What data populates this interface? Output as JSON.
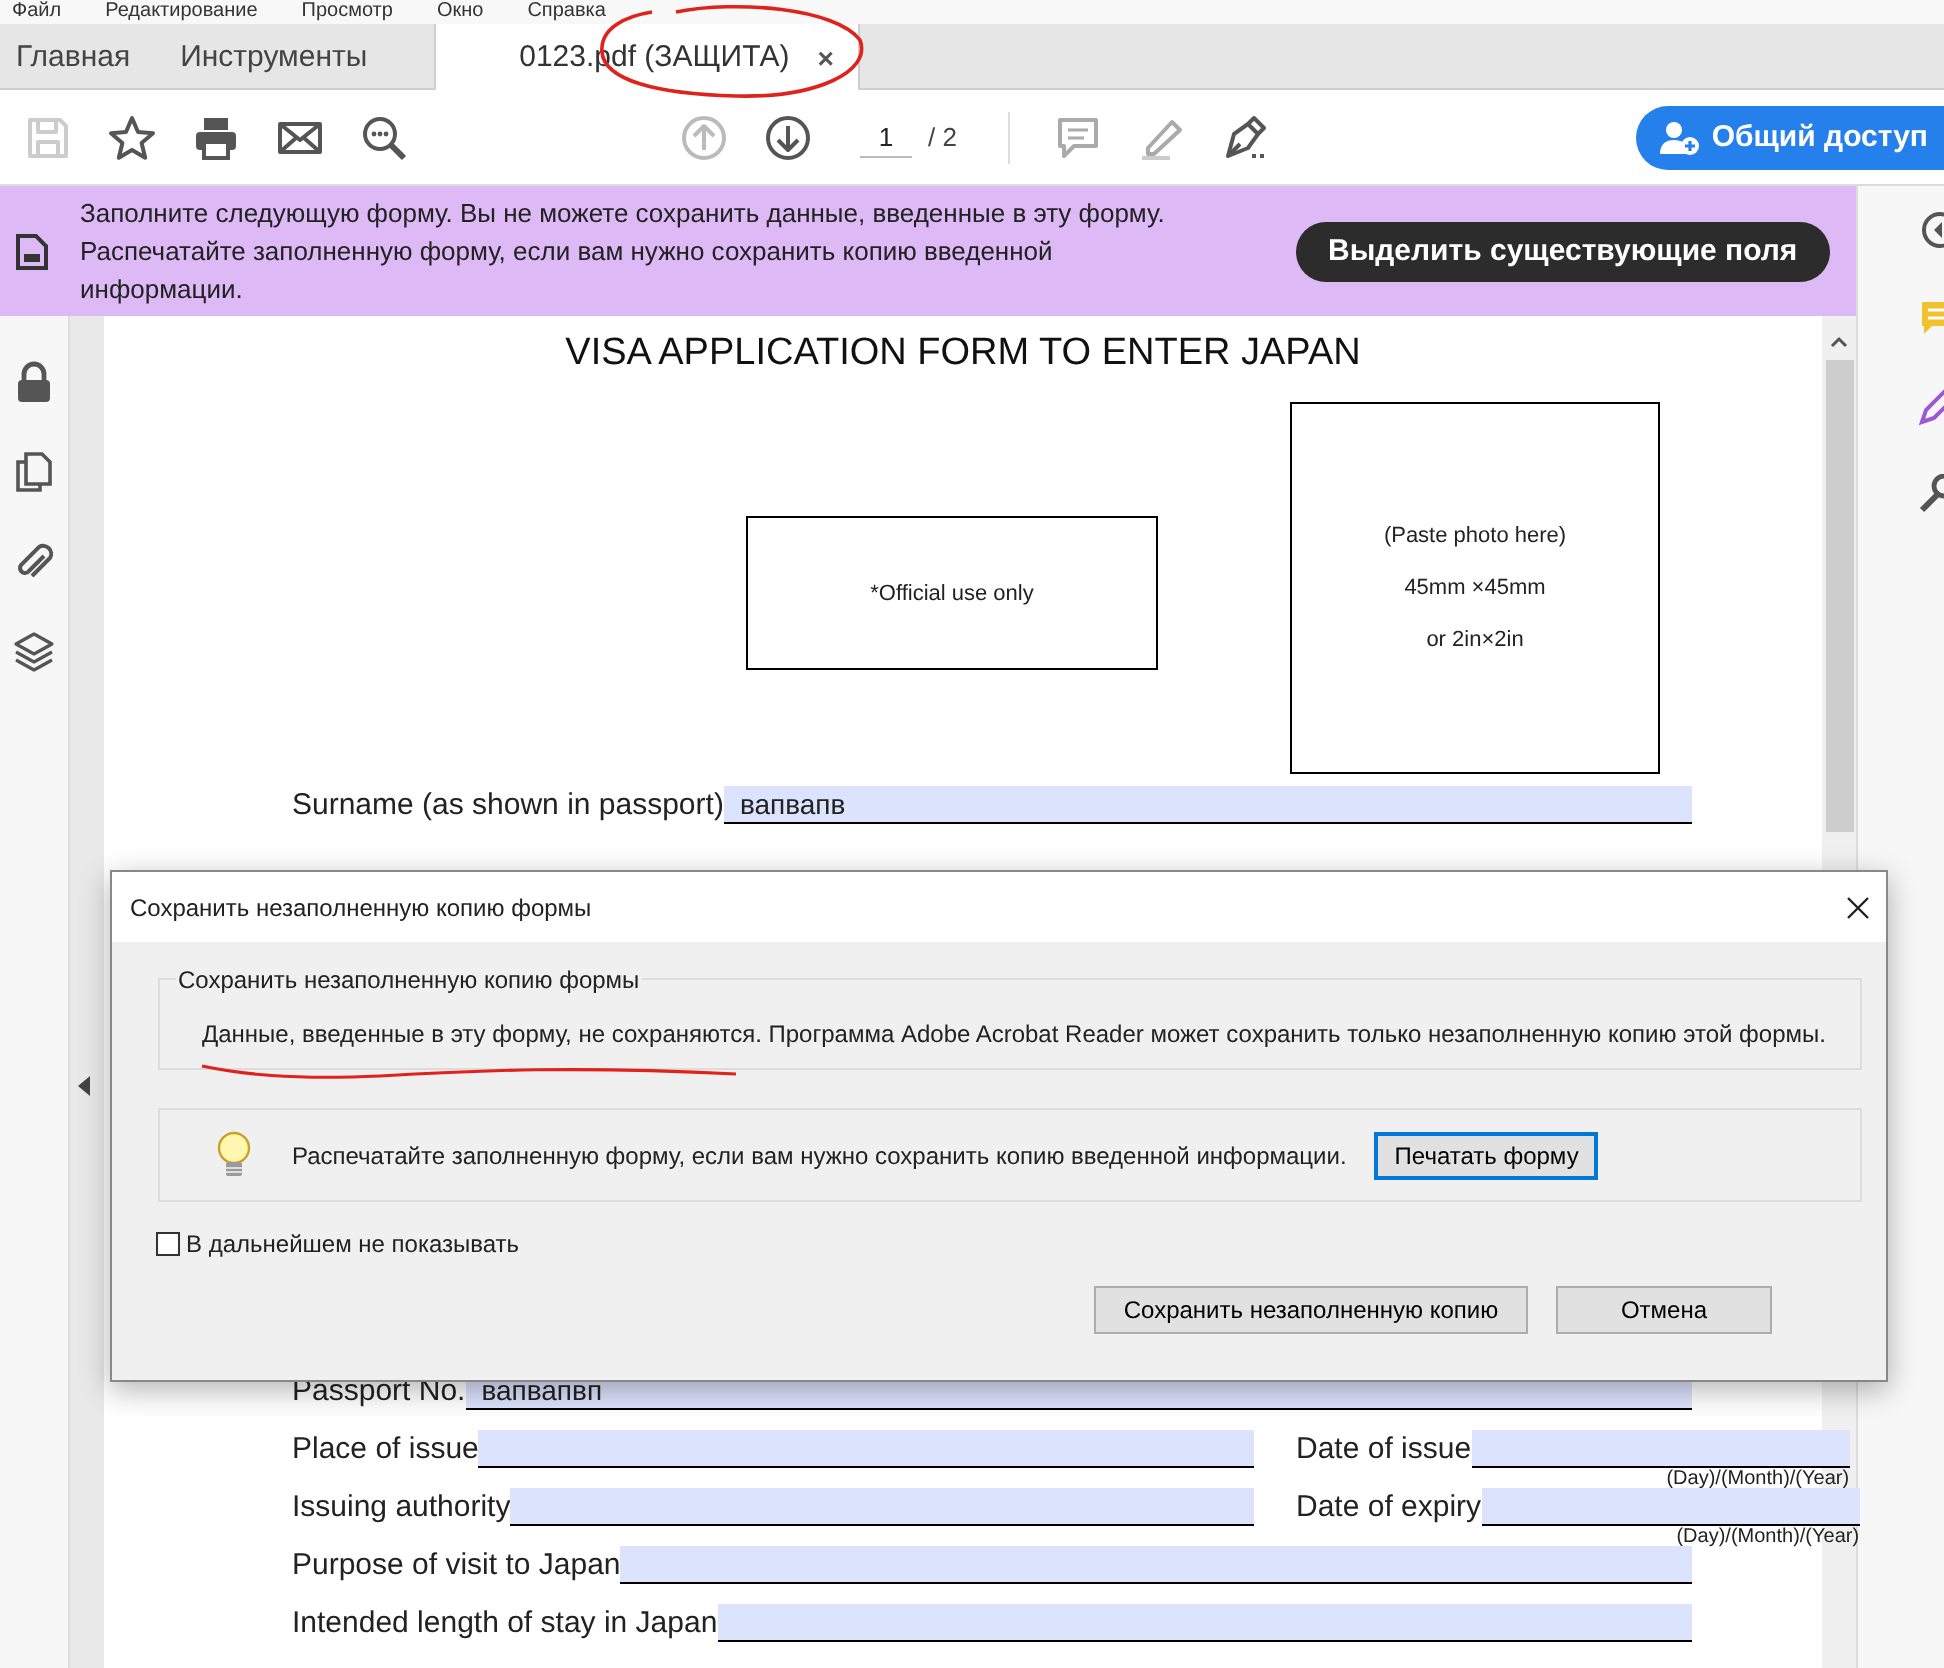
{
  "menu_bar": [
    "Файл",
    "Редактирование",
    "Просмотр",
    "Окно",
    "Справка"
  ],
  "tabs": [
    {
      "label": "Главная",
      "selected": false
    },
    {
      "label": "Инструменты",
      "selected": false
    },
    {
      "label": "0123.pdf (ЗАЩИТА)",
      "selected": true,
      "close": "×"
    }
  ],
  "toolbar": {
    "page": "1",
    "page_total": "/ 2",
    "share_button": "Общий доступ"
  },
  "banner": {
    "message": "Заполните следующую форму. Вы не можете сохранить данные, введенные в эту форму. Распечатайте заполненную форму, если вам нужно сохранить копию введенной информации.",
    "button": "Выделить существующие поля"
  },
  "document": {
    "title": "VISA APPLICATION FORM TO ENTER JAPAN",
    "official_box": "*Official use only",
    "photo_box": [
      "(Paste photo here)",
      "45mm ×45mm",
      "or 2in×2in"
    ],
    "top_rows": [
      {
        "fields": [
          {
            "label": "Surname (as shown in passport)",
            "value": "вапвапв"
          }
        ]
      }
    ],
    "bottom_rows": [
      {
        "fields": [
          {
            "label": "Passport No.",
            "value": "вапвапвп"
          }
        ]
      },
      {
        "fields": [
          {
            "label": "Place of issue"
          },
          {
            "label": "Date of issue",
            "hint": "(Day)/(Month)/(Year)"
          }
        ]
      },
      {
        "fields": [
          {
            "label": "Issuing authority"
          },
          {
            "label": "Date of expiry",
            "hint": "(Day)/(Month)/(Year)"
          }
        ]
      },
      {
        "fields": [
          {
            "label": "Purpose of visit to Japan"
          }
        ]
      },
      {
        "fields": [
          {
            "label": "Intended length of stay in Japan"
          }
        ]
      }
    ]
  },
  "dialog": {
    "title": "Сохранить незаполненную копию формы",
    "group_title": "Сохранить незаполненную копию формы",
    "message": "Данные, введенные в эту форму, не сохраняются. Программа Adobe Acrobat Reader может сохранить только незаполненную копию этой формы.",
    "tip": "Распечатайте заполненную форму, если вам нужно сохранить копию введенной информации.",
    "print_button": "Печатать форму",
    "checkbox": {
      "label": "В дальнейшем не показывать",
      "checked": false
    },
    "buttons": [
      "Сохранить незаполненную копию",
      "Отмена"
    ]
  }
}
